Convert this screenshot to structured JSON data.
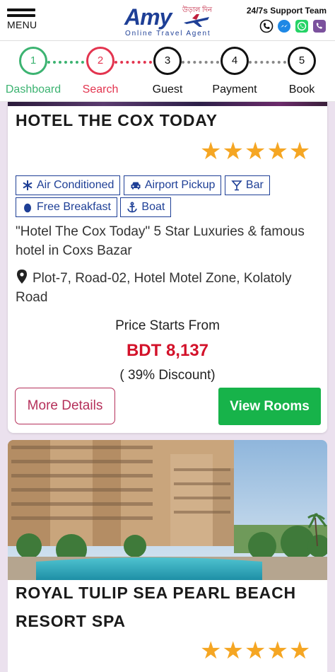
{
  "header": {
    "menu_label": "MENU",
    "brand": "Amy",
    "brand_bengali": "উড়াল দিন",
    "tagline": "Online Travel Agent",
    "support_title": "24/7s Support Team",
    "support_icons": [
      "phone-icon",
      "messenger-icon",
      "whatsapp-icon",
      "viber-icon"
    ]
  },
  "steps": [
    {
      "number": "1",
      "label": "Dashboard",
      "color": "#3cb371"
    },
    {
      "number": "2",
      "label": "Search",
      "color": "#e3344f"
    },
    {
      "number": "3",
      "label": "Guest",
      "color": "#111111"
    },
    {
      "number": "4",
      "label": "Payment",
      "color": "#111111"
    },
    {
      "number": "5",
      "label": "Book",
      "color": "#111111"
    }
  ],
  "hotels": [
    {
      "name": "HOTEL THE COX TODAY",
      "rating": 5,
      "stars": "★★★★★",
      "amenities": [
        {
          "icon": "snowflake-icon",
          "label": "Air Conditioned"
        },
        {
          "icon": "car-icon",
          "label": "Airport Pickup"
        },
        {
          "icon": "cocktail-icon",
          "label": "Bar"
        },
        {
          "icon": "egg-icon",
          "label": "Free Breakfast"
        },
        {
          "icon": "anchor-icon",
          "label": "Boat"
        }
      ],
      "description": "\"Hotel The Cox Today\" 5 Star Luxuries & famous hotel in Coxs Bazar",
      "address": "Plot-7, Road-02, Hotel Motel Zone, Kolatoly Road",
      "price_label": "Price Starts From",
      "price": "BDT 8,137",
      "discount": "( 39% Discount)",
      "more_details_label": "More Details",
      "view_rooms_label": "View Rooms"
    },
    {
      "name_line1": "ROYAL TULIP SEA PEARL BEACH",
      "name_line2": "RESORT SPA",
      "rating": 5,
      "stars": "★★★★★"
    }
  ],
  "colors": {
    "brand_blue": "#1e3f96",
    "price_red": "#d3122a",
    "view_rooms_green": "#17b34a",
    "more_details_border": "#b5305a",
    "star_gold": "#f5a623",
    "page_bg": "#ebe1ee"
  }
}
